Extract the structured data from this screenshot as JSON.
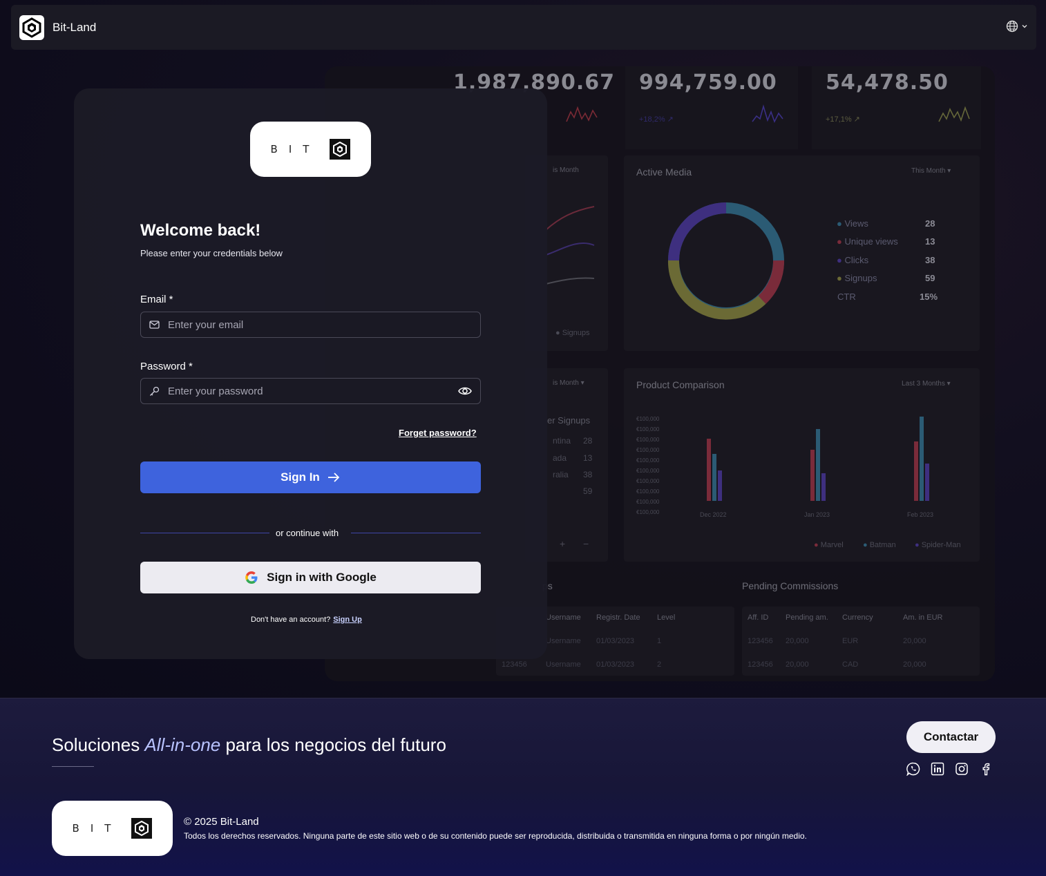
{
  "navbar": {
    "brand": "Bit-Land",
    "language_icon": "globe-icon"
  },
  "dashboard_preview": {
    "kpis": [
      {
        "value": "1,987,890.67",
        "change": ""
      },
      {
        "value": "994,759.00",
        "change": "+18,2% ↗"
      },
      {
        "value": "54,478.50",
        "change": "+17,1% ↗"
      }
    ],
    "active_media": {
      "title": "Active Media",
      "filter": "This Month",
      "legend": [
        {
          "label": "Views",
          "value": "28",
          "color": "#2b5b74"
        },
        {
          "label": "Unique views",
          "value": "13",
          "color": "#7a2b3a"
        },
        {
          "label": "Clicks",
          "value": "38",
          "color": "#3e2f7f"
        },
        {
          "label": "Signups",
          "value": "59",
          "color": "#6b6a35"
        },
        {
          "label": "CTR",
          "value": "15%",
          "color": ""
        }
      ]
    },
    "left_panel": {
      "filter": "is Month",
      "legend": "Signups"
    },
    "product_comparison": {
      "title": "Product Comparison",
      "filter": "Last 3 Months",
      "y_ticks": [
        "€100,000",
        "€100,000",
        "€100,000",
        "€100,000",
        "€100,000",
        "€100,000",
        "€100,000",
        "€100,000",
        "€100,000",
        "€100,000"
      ],
      "groups": [
        "Dec 2022",
        "Jan 2023",
        "Feb 2023"
      ],
      "legend": [
        "Marvel",
        "Batman",
        "Spider-Man"
      ]
    },
    "country_panel": {
      "filter": "is Month",
      "title": "er Signups",
      "rows": [
        {
          "name": "ntina",
          "value": "28"
        },
        {
          "name": "ada",
          "value": "13"
        },
        {
          "name": "ralia",
          "value": "38"
        },
        {
          "name": "",
          "value": "59"
        }
      ]
    },
    "pending_commissions": {
      "title": "Pending Commissions",
      "headers": [
        "Aff. ID",
        "Pending am.",
        "Currency",
        "Am. in EUR"
      ],
      "rows": [
        [
          "123456",
          "20,000",
          "EUR",
          "20,000"
        ],
        [
          "123456",
          "20,000",
          "CAD",
          "20,000"
        ]
      ]
    },
    "users_table": {
      "title": "ps",
      "headers": [
        "Username",
        "Registr. Date",
        "Level"
      ],
      "rows": [
        [
          "123456",
          "Username",
          "01/03/2023",
          "1"
        ],
        [
          "123456",
          "Username",
          "01/03/2023",
          "2"
        ]
      ]
    }
  },
  "login": {
    "logo_text": "BIT",
    "welcome": "Welcome back!",
    "subtitle": "Please enter your credentials below",
    "email_label": "Email *",
    "email_placeholder": "Enter your email",
    "password_label": "Password *",
    "password_placeholder": "Enter your password",
    "forgot": "Forget password?",
    "signin": "Sign In",
    "divider": "or continue with",
    "google": "Sign in with Google",
    "no_account": "Don't have an account?",
    "signup": "Sign Up"
  },
  "footer": {
    "tagline_start": "Soluciones ",
    "tagline_emphasis": "All-in-one",
    "tagline_end": " para los negocios del futuro",
    "contact": "Contactar",
    "logo_text": "BIT",
    "copyright": "© 2025 Bit-Land",
    "rights": "Todos los derechos reservados. Ninguna parte de este sitio web o de su contenido puede ser reproducida, distribuida o transmitida en ninguna forma o por ningún medio."
  },
  "colors": {
    "primary": "#3e63dd",
    "card": "#1c1b26",
    "footer": "#1d1b3d"
  }
}
